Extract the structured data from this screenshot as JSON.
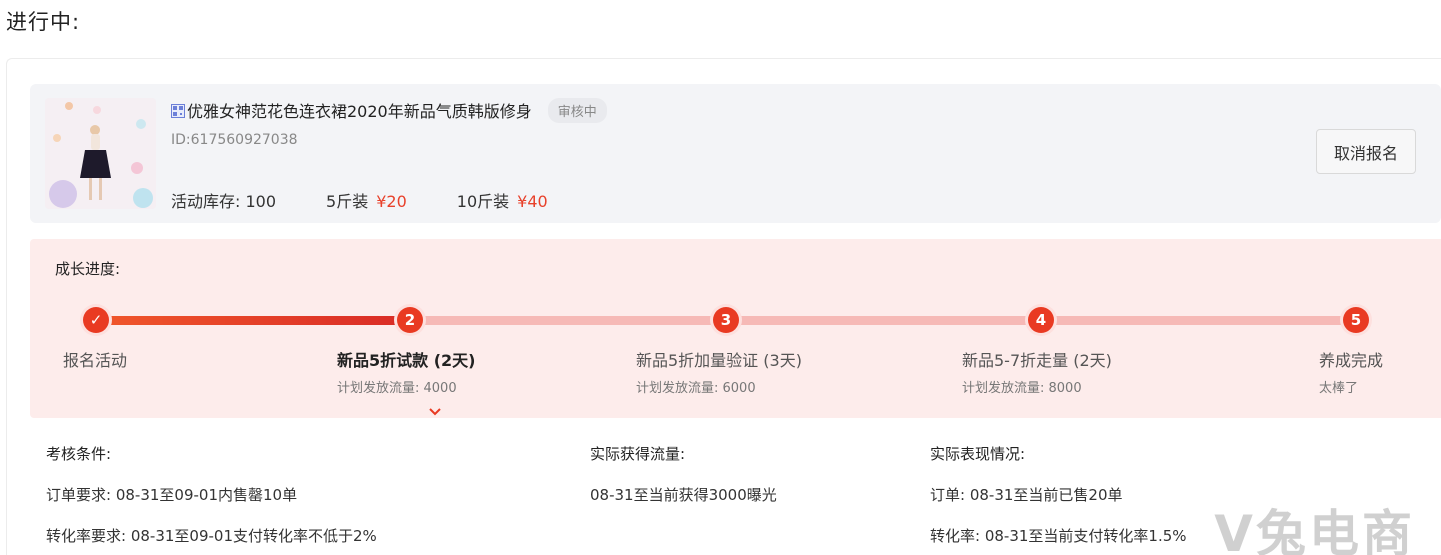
{
  "section_title": "进行中:",
  "product": {
    "title": "优雅女神范花色连衣裙2020年新品气质韩版修身",
    "status": "审核中",
    "id": "ID:617560927038",
    "stock_label": "活动库存:",
    "stock_value": "100",
    "spec1_label": "5斤装",
    "spec1_price": "¥20",
    "spec2_label": "10斤装",
    "spec2_price": "¥40",
    "cancel_label": "取消报名"
  },
  "progress": {
    "label": "成长进度:",
    "current_step": 2,
    "steps": [
      {
        "num": "✓",
        "name": "报名活动",
        "sub": ""
      },
      {
        "num": "2",
        "name": "新品5折试款 (2天)",
        "sub": "计划发放流量: 4000"
      },
      {
        "num": "3",
        "name": "新品5折加量验证 (3天)",
        "sub": "计划发放流量: 6000"
      },
      {
        "num": "4",
        "name": "新品5-7折走量 (2天)",
        "sub": "计划发放流量: 8000"
      },
      {
        "num": "5",
        "name": "养成完成",
        "sub": "太棒了"
      }
    ]
  },
  "details": {
    "criteria": {
      "head": "考核条件:",
      "lines": [
        "订单要求: 08-31至09-01内售罄10单",
        "转化率要求: 08-31至09-01支付转化率不低于2%"
      ]
    },
    "traffic": {
      "head": "实际获得流量:",
      "lines": [
        "08-31至当前获得3000曝光"
      ]
    },
    "performance": {
      "head": "实际表现情况:",
      "lines": [
        "订单: 08-31至当前已售20单",
        "转化率: 08-31至当前支付转化率1.5%"
      ]
    }
  },
  "watermark": "V兔电商"
}
